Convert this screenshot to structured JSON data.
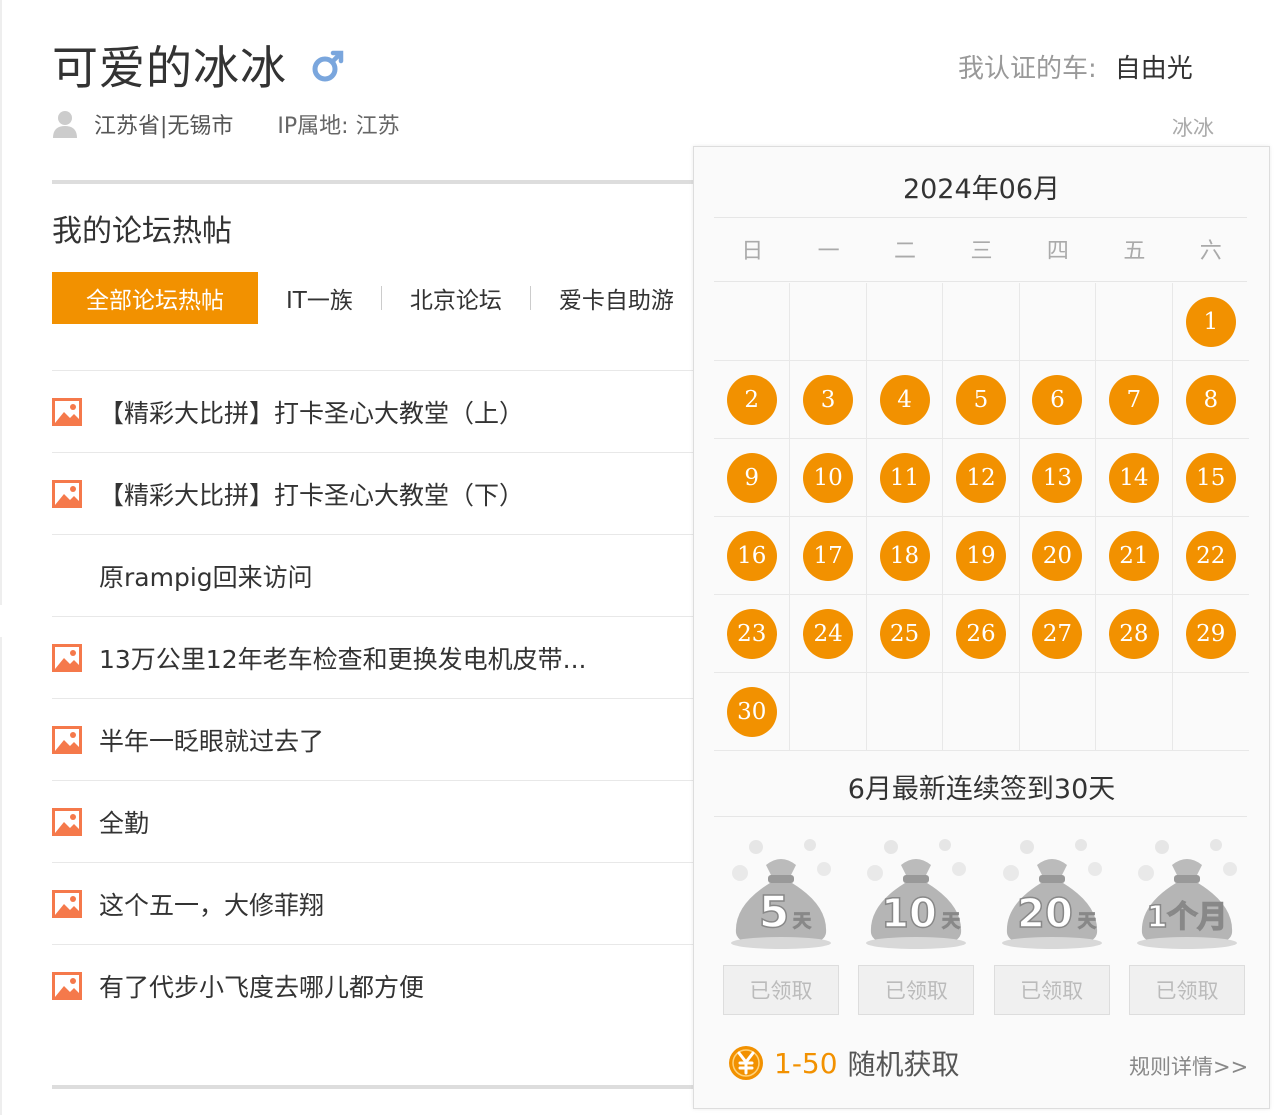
{
  "profile": {
    "name": "可爱的冰冰",
    "gender_icon": "male-icon",
    "location": "江苏省|无锡市",
    "ip": "IP属地: 江苏",
    "car_label": "我认证的车:",
    "car_value": "自由光",
    "nickname": "冰冰"
  },
  "forum": {
    "section_title": "我的论坛热帖",
    "tabs": [
      {
        "label": "全部论坛热帖",
        "active": true
      },
      {
        "label": "IT一族",
        "active": false
      },
      {
        "label": "北京论坛",
        "active": false
      },
      {
        "label": "爱卡自助游",
        "active": false
      }
    ],
    "posts": [
      {
        "title": "【精彩大比拼】打卡圣心大教堂（上）",
        "has_image": true
      },
      {
        "title": "【精彩大比拼】打卡圣心大教堂（下）",
        "has_image": true
      },
      {
        "title": "原rampig回来访问",
        "has_image": false
      },
      {
        "title": "13万公里12年老车检查和更换发电机皮带...",
        "has_image": true
      },
      {
        "title": "半年一眨眼就过去了",
        "has_image": true
      },
      {
        "title": "全勤",
        "has_image": true
      },
      {
        "title": "这个五一，大修菲翔",
        "has_image": true
      },
      {
        "title": "有了代步小飞度去哪儿都方便",
        "has_image": true
      }
    ]
  },
  "calendar": {
    "month": "2024年06月",
    "weekdays": [
      "日",
      "一",
      "二",
      "三",
      "四",
      "五",
      "六"
    ],
    "first_weekday_index": 6,
    "days_in_month": 30,
    "checked_days": [
      1,
      2,
      3,
      4,
      5,
      6,
      7,
      8,
      9,
      10,
      11,
      12,
      13,
      14,
      15,
      16,
      17,
      18,
      19,
      20,
      21,
      22,
      23,
      24,
      25,
      26,
      27,
      28,
      29,
      30
    ],
    "streak_text": "6月最新连续签到30天",
    "accent_color": "#f29100"
  },
  "rewards": [
    {
      "bag_label": "5天",
      "bag_big": "5",
      "bag_small": "天",
      "button": "已领取"
    },
    {
      "bag_label": "10天",
      "bag_big": "10",
      "bag_small": "天",
      "button": "已领取"
    },
    {
      "bag_label": "20天",
      "bag_big": "20",
      "bag_small": "天",
      "button": "已领取"
    },
    {
      "bag_label": "1个月",
      "bag_big": "1个月",
      "bag_small": "",
      "button": "已领取"
    }
  ],
  "random_reward": {
    "range": "1-50",
    "text": "随机获取",
    "rules_link": "规则详情>>"
  }
}
